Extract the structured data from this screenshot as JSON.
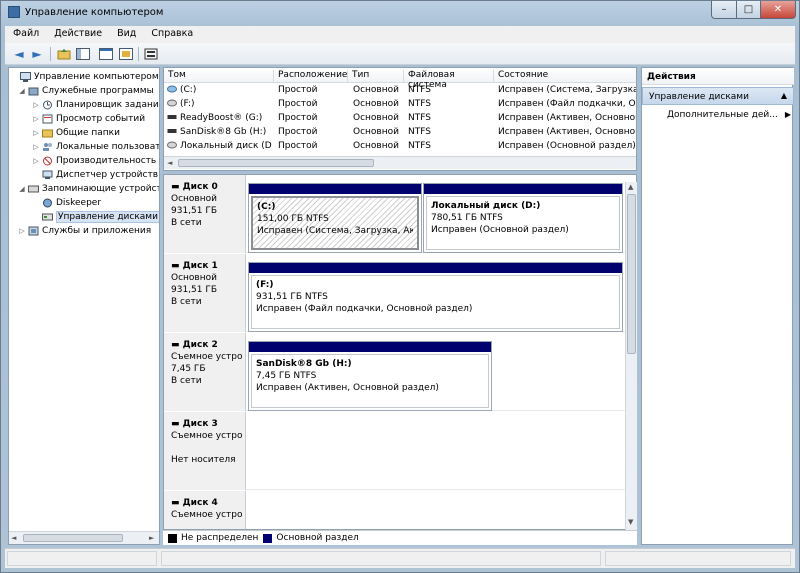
{
  "window": {
    "title": "Управление компьютером",
    "min_glyph": "–",
    "max_glyph": "□",
    "close_glyph": "✕"
  },
  "menu": {
    "file": "Файл",
    "action": "Действие",
    "view": "Вид",
    "help": "Справка"
  },
  "toolbar": {
    "back_icon": "◄",
    "forward_icon": "►",
    "up_icon": "folder-up-icon",
    "show_tree_icon": "console-tree-icon",
    "help_icon": "help-icon",
    "properties_icon": "properties-icon"
  },
  "tree": {
    "root": "Управление компьютером (л",
    "utilities": "Служебные программы",
    "scheduler": "Планировщик заданий",
    "events": "Просмотр событий",
    "shared": "Общие папки",
    "users": "Локальные пользовате",
    "perf": "Производительность",
    "devices": "Диспетчер устройств",
    "storage": "Запоминающие устройст",
    "diskeeper": "Diskeeper",
    "diskmgmt": "Управление дисками",
    "services": "Службы и приложения"
  },
  "volumes": {
    "headers": [
      "Том",
      "Расположение",
      "Тип",
      "Файловая система",
      "Состояние"
    ],
    "rows": [
      {
        "name": "(C:)",
        "layout": "Простой",
        "type": "Основной",
        "fs": "NTFS",
        "status": "Исправен (Система, Загрузка, Ак"
      },
      {
        "name": "(F:)",
        "layout": "Простой",
        "type": "Основной",
        "fs": "NTFS",
        "status": "Исправен (Файл подкачки, Осно"
      },
      {
        "name": "ReadyBoost® (G:)",
        "layout": "Простой",
        "type": "Основной",
        "fs": "NTFS",
        "status": "Исправен (Активен, Основной р"
      },
      {
        "name": "SanDisk®8 Gb (H:)",
        "layout": "Простой",
        "type": "Основной",
        "fs": "NTFS",
        "status": "Исправен (Активен, Основной р"
      },
      {
        "name": "Локальный диск (D:)",
        "layout": "Простой",
        "type": "Основной",
        "fs": "NTFS",
        "status": "Исправен (Основной раздел)"
      }
    ]
  },
  "disks": [
    {
      "name": "Диск 0",
      "kind": "Основной",
      "size": "931,51 ГБ",
      "state": "В сети"
    },
    {
      "name": "Диск 1",
      "kind": "Основной",
      "size": "931,51 ГБ",
      "state": "В сети"
    },
    {
      "name": "Диск 2",
      "kind": "Съемное устро",
      "size": "7,45 ГБ",
      "state": "В сети"
    },
    {
      "name": "Диск 3",
      "kind": "Съемное устро",
      "size": "",
      "state": "Нет носителя"
    },
    {
      "name": "Диск 4",
      "kind": "Съемное устро",
      "size": "",
      "state": ""
    }
  ],
  "partitions": {
    "c": {
      "title": "(C:)",
      "size": "151,00 ГБ NTFS",
      "status": "Исправен (Система, Загрузка, Активе"
    },
    "d": {
      "title": "Локальный диск  (D:)",
      "size": "780,51 ГБ NTFS",
      "status": "Исправен (Основной раздел)"
    },
    "f": {
      "title": "(F:)",
      "size": "931,51 ГБ NTFS",
      "status": "Исправен (Файл подкачки, Основной раздел)"
    },
    "h": {
      "title": "SanDisk®8 Gb  (H:)",
      "size": "7,45 ГБ NTFS",
      "status": "Исправен (Активен, Основной раздел)"
    }
  },
  "legend": {
    "unallocated": "Не распределен",
    "primary": "Основной раздел",
    "unallocated_color": "#000000",
    "primary_color": "#00006e"
  },
  "actions": {
    "header": "Действия",
    "section": "Управление дисками",
    "more": "Дополнительные дей..."
  }
}
